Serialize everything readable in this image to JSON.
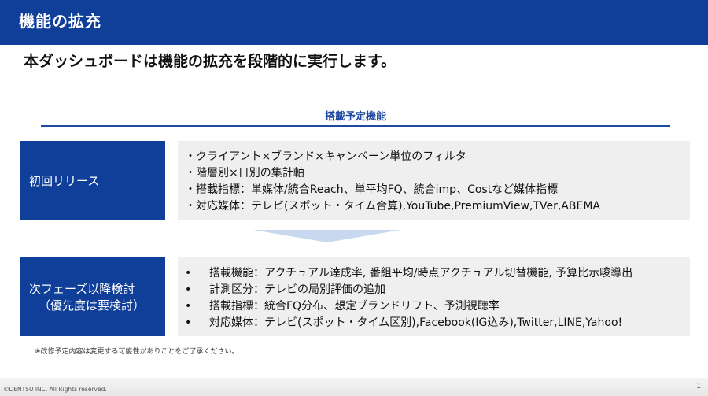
{
  "header": {
    "title": "機能の拡充"
  },
  "lead": "本ダッシュボードは機能の拡充を段階的に実行します。",
  "section": {
    "title": "搭載予定機能"
  },
  "phase1": {
    "label": "初回リリース",
    "items": [
      "・クライアント×ブランド×キャンペーン単位のフィルタ",
      "・階層別×日別の集計軸",
      "・搭載指標：単媒体/統合Reach、単平均FQ、統合imp、Costなど媒体指標",
      "・対応媒体：テレビ(スポット・タイム合算),YouTube,PremiumView,TVer,ABEMA"
    ]
  },
  "phase2": {
    "label_line1": "次フェーズ以降検討",
    "label_line2": "（優先度は要検討）",
    "bullet": "•",
    "items": [
      "搭載機能：アクチュアル達成率, 番組平均/時点アクチュアル切替機能, 予算比示唆導出",
      "計測区分：テレビの局別評価の追加",
      "搭載指標：統合FQ分布、想定ブランドリフト、予測視聴率",
      "対応媒体：テレビ(スポット・タイム区別),Facebook(IG込み),Twitter,LINE,Yahoo!"
    ]
  },
  "note": "※改修予定内容は変更する可能性がありことをご了承ください。",
  "footer": {
    "copyright": "©DENTSU INC. All Rights reserved.",
    "page_number": "1"
  },
  "colors": {
    "brand_blue": "#0f3f99",
    "accent_blue": "#1d49a0",
    "box_gray": "#efefef",
    "arrow_light_blue": "#c8d9ef"
  }
}
